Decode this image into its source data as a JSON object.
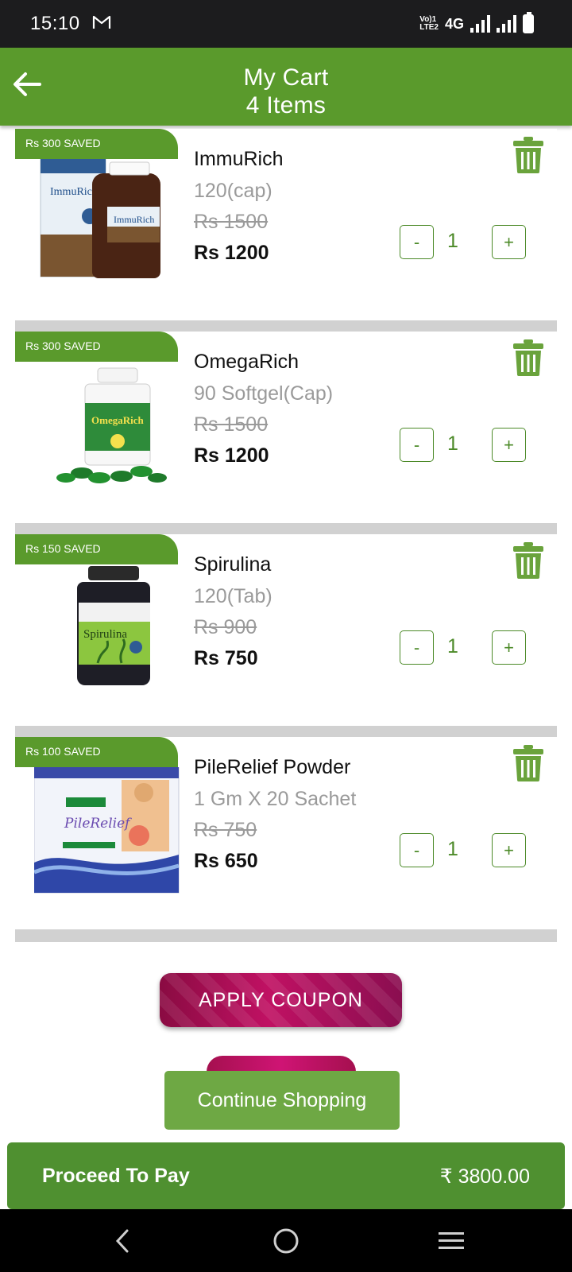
{
  "status_bar": {
    "time": "15:10",
    "network": "4G",
    "volte": "VoLTE2"
  },
  "header": {
    "title": "My Cart",
    "subtitle": "4 Items"
  },
  "items": [
    {
      "saved": "Rs 300 SAVED",
      "name": "ImmuRich",
      "pack": "120(cap)",
      "mrp": "Rs 1500",
      "price": "Rs 1200",
      "qty": "1"
    },
    {
      "saved": "Rs 300 SAVED",
      "name": "OmegaRich",
      "pack": "90 Softgel(Cap)",
      "mrp": "Rs 1500",
      "price": "Rs 1200",
      "qty": "1"
    },
    {
      "saved": "Rs 150 SAVED",
      "name": "Spirulina",
      "pack": "120(Tab)",
      "mrp": "Rs 900",
      "price": "Rs 750",
      "qty": "1"
    },
    {
      "saved": "Rs 100 SAVED",
      "name": "PileRelief Powder",
      "pack": "1 Gm X 20 Sachet",
      "mrp": "Rs 750",
      "price": "Rs 650",
      "qty": "1"
    }
  ],
  "qty_controls": {
    "minus": "-",
    "plus": "+"
  },
  "apply_coupon_label": "APPLY COUPON",
  "continue_shopping_label": "Continue Shopping",
  "pay": {
    "label": "Proceed To Pay",
    "total": "₹ 3800.00"
  },
  "icons": {
    "back": "arrow-left-icon",
    "delete": "trash-icon",
    "nav_back": "chevron-left-icon",
    "nav_home": "circle-home-icon",
    "nav_menu": "menu-icon"
  },
  "colors": {
    "primary_green": "#5a9a2c",
    "coupon_pink": "#c01163",
    "divider_gray": "#d1d1d1"
  }
}
